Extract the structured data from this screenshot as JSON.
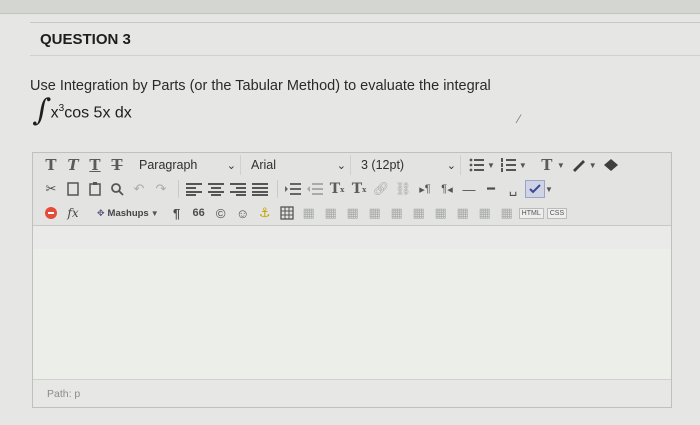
{
  "question": {
    "title": "QUESTION 3",
    "prompt": "Use Integration by Parts (or the Tabular Method) to evaluate the integral",
    "integral_sign": "∫",
    "integral_base": "x",
    "integral_exponent": "3",
    "integral_rest": "cos 5x dx"
  },
  "toolbar": {
    "row1": {
      "format_buttons": [
        "T",
        "T",
        "T",
        "T"
      ],
      "paragraph_select": "Paragraph",
      "font_select": "Arial",
      "size_select": "3 (12pt)",
      "text_color_label": "T"
    },
    "row2": {
      "superscript_label": "T",
      "subscript_label": "T",
      "ltr_label": "¶",
      "rtl_label": "¶"
    },
    "row3": {
      "function_label": "fx",
      "mashups_label": "Mashups",
      "paragraph_mark": "¶",
      "quote_label": "66",
      "html_label": "HTML",
      "css_label": "CSS"
    }
  },
  "status": {
    "path_label": "Path: p"
  },
  "colors": {
    "background": "#e6e7e4",
    "spell_icon": "#e34b3a",
    "link_icon": "#c9a200",
    "toggle_icon": "#2b8fd0"
  }
}
